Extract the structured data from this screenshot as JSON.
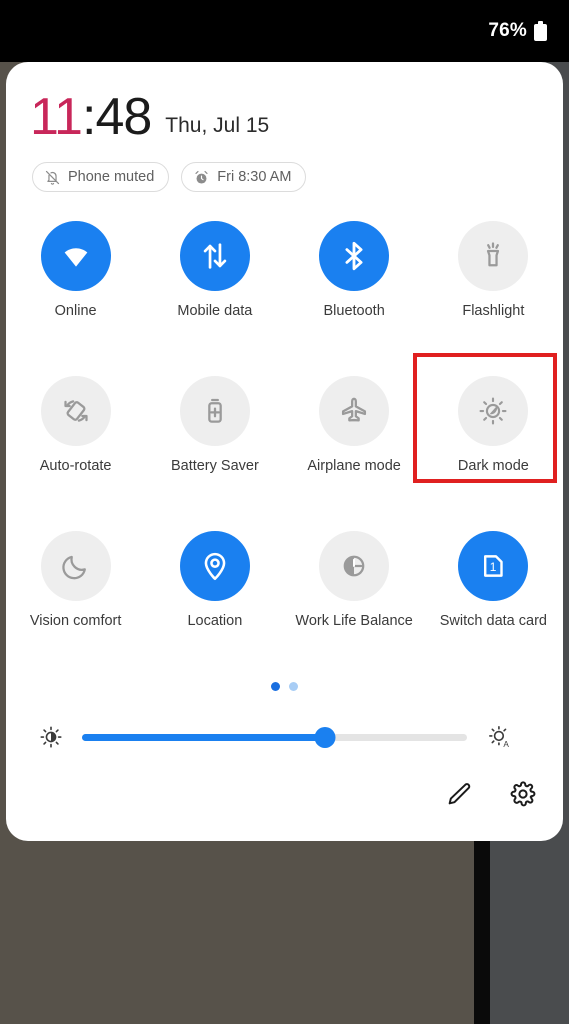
{
  "statusbar": {
    "battery_percent": "76%",
    "battery_icon": "battery-full-icon"
  },
  "panel": {
    "clock": {
      "hours": "11",
      "separator": ":",
      "minutes": "48",
      "hours_color": "#c8275a",
      "minutes_color": "#1b1b1b",
      "date": "Thu, Jul 15"
    },
    "chips": [
      {
        "label": "Phone muted",
        "icon": "bell-slash-icon"
      },
      {
        "label": "Fri 8:30 AM",
        "icon": "alarm-clock-icon"
      }
    ],
    "tiles": [
      [
        {
          "label": "Online",
          "icon": "wifi-icon",
          "active": true
        },
        {
          "label": "Mobile data",
          "icon": "data-transfer-icon",
          "active": true
        },
        {
          "label": "Bluetooth",
          "icon": "bluetooth-icon",
          "active": true
        },
        {
          "label": "Flashlight",
          "icon": "flashlight-icon",
          "active": false
        }
      ],
      [
        {
          "label": "Auto-rotate",
          "icon": "auto-rotate-icon",
          "active": false
        },
        {
          "label": "Battery Saver",
          "icon": "battery-plus-icon",
          "active": false
        },
        {
          "label": "Airplane mode",
          "icon": "airplane-icon",
          "active": false
        },
        {
          "label": "Dark mode",
          "icon": "dark-mode-icon",
          "active": false
        }
      ],
      [
        {
          "label": "Vision comfort",
          "icon": "moon-icon",
          "active": false
        },
        {
          "label": "Location",
          "icon": "location-pin-icon",
          "active": true
        },
        {
          "label": "Work Life Balance",
          "icon": "work-life-icon",
          "active": false
        },
        {
          "label": "Switch data card",
          "icon": "sim-card-1-icon",
          "active": true
        }
      ]
    ],
    "pagination": {
      "total": 2,
      "current": 1
    },
    "brightness": {
      "value_percent": 63,
      "low_icon": "brightness-low-icon",
      "auto_icon": "brightness-auto-icon"
    },
    "footer": [
      {
        "name": "edit-button",
        "icon": "pencil-icon"
      },
      {
        "name": "settings-button",
        "icon": "gear-icon"
      }
    ]
  },
  "annotation": {
    "target_label": "Dark mode",
    "color": "#e02020"
  },
  "colors": {
    "accent_blue": "#1a80f0",
    "tile_off_bg": "#eeeeee",
    "panel_bg": "#ffffff",
    "statusbar_bg": "#000000"
  }
}
